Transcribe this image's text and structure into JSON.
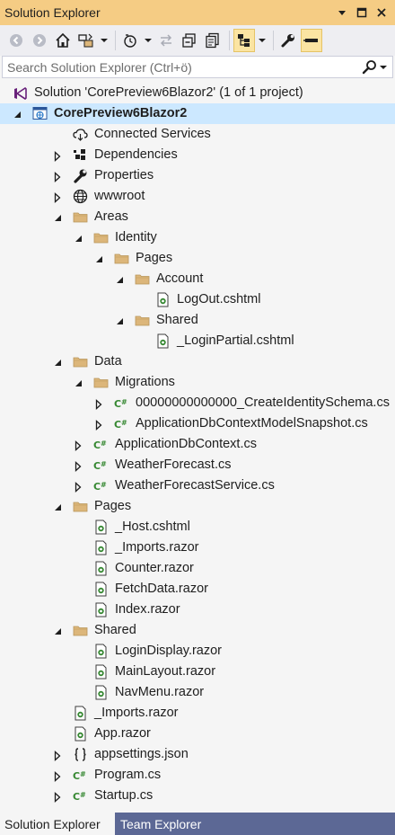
{
  "window": {
    "title": "Solution Explorer"
  },
  "toolbar": {
    "buttons": [
      "back-icon",
      "forward-icon",
      "home-icon",
      "switch-views-icon",
      "pending-changes-icon",
      "sync-icon",
      "collapse-all-icon",
      "show-all-files-icon",
      "preview-selected-icon",
      "properties-icon",
      "pin-icon"
    ]
  },
  "search": {
    "placeholder": "Search Solution Explorer (Ctrl+ö)"
  },
  "tree": [
    {
      "label": "Solution 'CorePreview6Blazor2' (1 of 1 project)",
      "icon": "solution-icon",
      "level": 0,
      "exp": "none"
    },
    {
      "label": "CorePreview6Blazor2",
      "icon": "web-project-icon",
      "level": 0,
      "exp": "open",
      "bold": true,
      "selected": true
    },
    {
      "label": "Connected Services",
      "icon": "connected-services-icon",
      "level": 1,
      "exp": "none"
    },
    {
      "label": "Dependencies",
      "icon": "dependencies-icon",
      "level": 1,
      "exp": "closed"
    },
    {
      "label": "Properties",
      "icon": "wrench-icon",
      "level": 1,
      "exp": "closed"
    },
    {
      "label": "wwwroot",
      "icon": "globe-icon",
      "level": 1,
      "exp": "closed"
    },
    {
      "label": "Areas",
      "icon": "folder-icon",
      "level": 1,
      "exp": "open"
    },
    {
      "label": "Identity",
      "icon": "folder-icon",
      "level": 2,
      "exp": "open"
    },
    {
      "label": "Pages",
      "icon": "folder-icon",
      "level": 3,
      "exp": "open"
    },
    {
      "label": "Account",
      "icon": "folder-icon",
      "level": 4,
      "exp": "open"
    },
    {
      "label": "LogOut.cshtml",
      "icon": "razor-file-icon",
      "level": 5,
      "exp": "none"
    },
    {
      "label": "Shared",
      "icon": "folder-icon",
      "level": 4,
      "exp": "open"
    },
    {
      "label": "_LoginPartial.cshtml",
      "icon": "razor-file-icon",
      "level": 5,
      "exp": "none"
    },
    {
      "label": "Data",
      "icon": "folder-icon",
      "level": 1,
      "exp": "open"
    },
    {
      "label": "Migrations",
      "icon": "folder-icon",
      "level": 2,
      "exp": "open"
    },
    {
      "label": "00000000000000_CreateIdentitySchema.cs",
      "icon": "csharp-icon",
      "level": 3,
      "exp": "closed"
    },
    {
      "label": "ApplicationDbContextModelSnapshot.cs",
      "icon": "csharp-icon",
      "level": 3,
      "exp": "closed"
    },
    {
      "label": "ApplicationDbContext.cs",
      "icon": "csharp-icon",
      "level": 2,
      "exp": "closed"
    },
    {
      "label": "WeatherForecast.cs",
      "icon": "csharp-icon",
      "level": 2,
      "exp": "closed"
    },
    {
      "label": "WeatherForecastService.cs",
      "icon": "csharp-icon",
      "level": 2,
      "exp": "closed"
    },
    {
      "label": "Pages",
      "icon": "folder-icon",
      "level": 1,
      "exp": "open"
    },
    {
      "label": "_Host.cshtml",
      "icon": "razor-file-icon",
      "level": 2,
      "exp": "none"
    },
    {
      "label": "_Imports.razor",
      "icon": "razor-file-icon",
      "level": 2,
      "exp": "none"
    },
    {
      "label": "Counter.razor",
      "icon": "razor-file-icon",
      "level": 2,
      "exp": "none"
    },
    {
      "label": "FetchData.razor",
      "icon": "razor-file-icon",
      "level": 2,
      "exp": "none"
    },
    {
      "label": "Index.razor",
      "icon": "razor-file-icon",
      "level": 2,
      "exp": "none"
    },
    {
      "label": "Shared",
      "icon": "folder-icon",
      "level": 1,
      "exp": "open"
    },
    {
      "label": "LoginDisplay.razor",
      "icon": "razor-file-icon",
      "level": 2,
      "exp": "none"
    },
    {
      "label": "MainLayout.razor",
      "icon": "razor-file-icon",
      "level": 2,
      "exp": "none"
    },
    {
      "label": "NavMenu.razor",
      "icon": "razor-file-icon",
      "level": 2,
      "exp": "none"
    },
    {
      "label": "_Imports.razor",
      "icon": "razor-file-icon",
      "level": 1,
      "exp": "none"
    },
    {
      "label": "App.razor",
      "icon": "razor-file-icon",
      "level": 1,
      "exp": "none"
    },
    {
      "label": "appsettings.json",
      "icon": "json-file-icon",
      "level": 1,
      "exp": "closed"
    },
    {
      "label": "Program.cs",
      "icon": "csharp-icon",
      "level": 1,
      "exp": "closed"
    },
    {
      "label": "Startup.cs",
      "icon": "csharp-icon",
      "level": 1,
      "exp": "closed"
    }
  ],
  "tabs": {
    "active": "Solution Explorer",
    "inactive": "Team Explorer"
  },
  "colors": {
    "title_bar": "#f5cc84",
    "selection": "#cce8ff",
    "tab_strip": "#5c6895",
    "folder": "#dcb67a",
    "csharp": "#368832"
  }
}
